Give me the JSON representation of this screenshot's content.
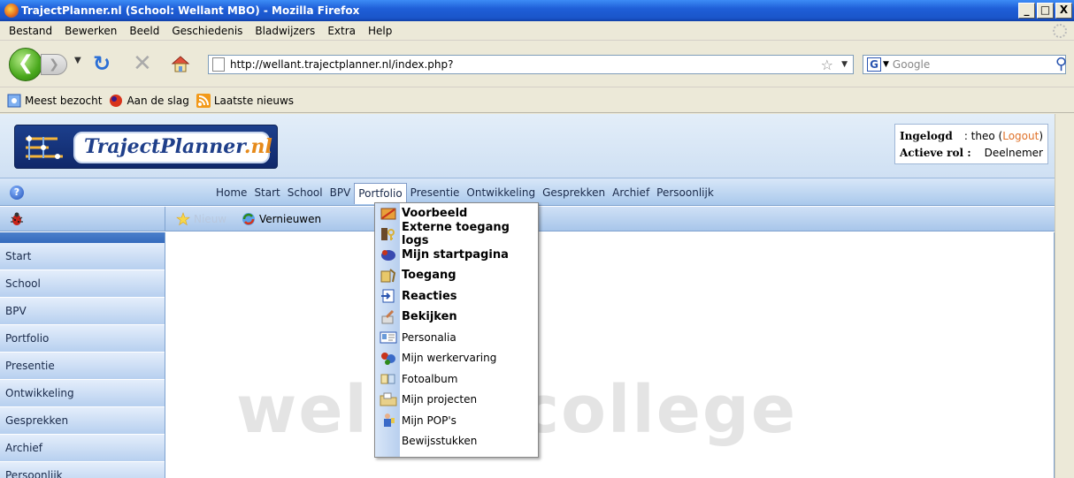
{
  "window": {
    "title": "TrajectPlanner.nl (School: Wellant MBO) - Mozilla Firefox",
    "btn_min": "_",
    "btn_max": "□",
    "btn_close": "X"
  },
  "menubar": {
    "items": [
      "Bestand",
      "Bewerken",
      "Beeld",
      "Geschiedenis",
      "Bladwijzers",
      "Extra",
      "Help"
    ]
  },
  "navbar": {
    "url": "http://wellant.trajectplanner.nl/index.php?",
    "search_placeholder": "Google"
  },
  "bookmarks": {
    "items": [
      "Meest bezocht",
      "Aan de slag",
      "Laatste nieuws"
    ]
  },
  "header": {
    "logo_main": "TrajectPlanner",
    "logo_suffix": ".nl",
    "login_label": "Ingelogd",
    "login_user": ": theo (",
    "logout": "Logout",
    "login_close": ")",
    "role_label": "Actieve rol :",
    "role_value": "Deelnemer"
  },
  "topnav": {
    "items": [
      "Home",
      "Start",
      "School",
      "BPV",
      "Portfolio",
      "Presentie",
      "Ontwikkeling",
      "Gesprekken",
      "Archief",
      "Persoonlijk"
    ],
    "active": "Portfolio"
  },
  "toolbar": {
    "new_label": "Nieuw",
    "refresh_label": "Vernieuwen"
  },
  "sidebar": {
    "items": [
      "Start",
      "School",
      "BPV",
      "Portfolio",
      "Presentie",
      "Ontwikkeling",
      "Gesprekken",
      "Archief",
      "Persoonlijk"
    ]
  },
  "content": {
    "watermark": "wellantcollege"
  },
  "dropdown": {
    "items": [
      {
        "label": "Voorbeeld",
        "bold": true
      },
      {
        "label": "Externe toegang logs",
        "bold": true
      },
      {
        "label": "Mijn startpagina",
        "bold": true
      },
      {
        "label": "Toegang",
        "bold": true
      },
      {
        "label": "Reacties",
        "bold": true
      },
      {
        "label": "Bekijken",
        "bold": true
      },
      {
        "label": "Personalia",
        "bold": false
      },
      {
        "label": "Mijn werkervaring",
        "bold": false
      },
      {
        "label": "Fotoalbum",
        "bold": false
      },
      {
        "label": "Mijn projecten",
        "bold": false
      },
      {
        "label": "Mijn POP's",
        "bold": false
      },
      {
        "label": "Bewijsstukken",
        "bold": false
      }
    ]
  },
  "colors": {
    "accent_orange": "#e0722a",
    "nav_blue": "#a9c8ec",
    "logo_blue": "#1f3f8a"
  }
}
